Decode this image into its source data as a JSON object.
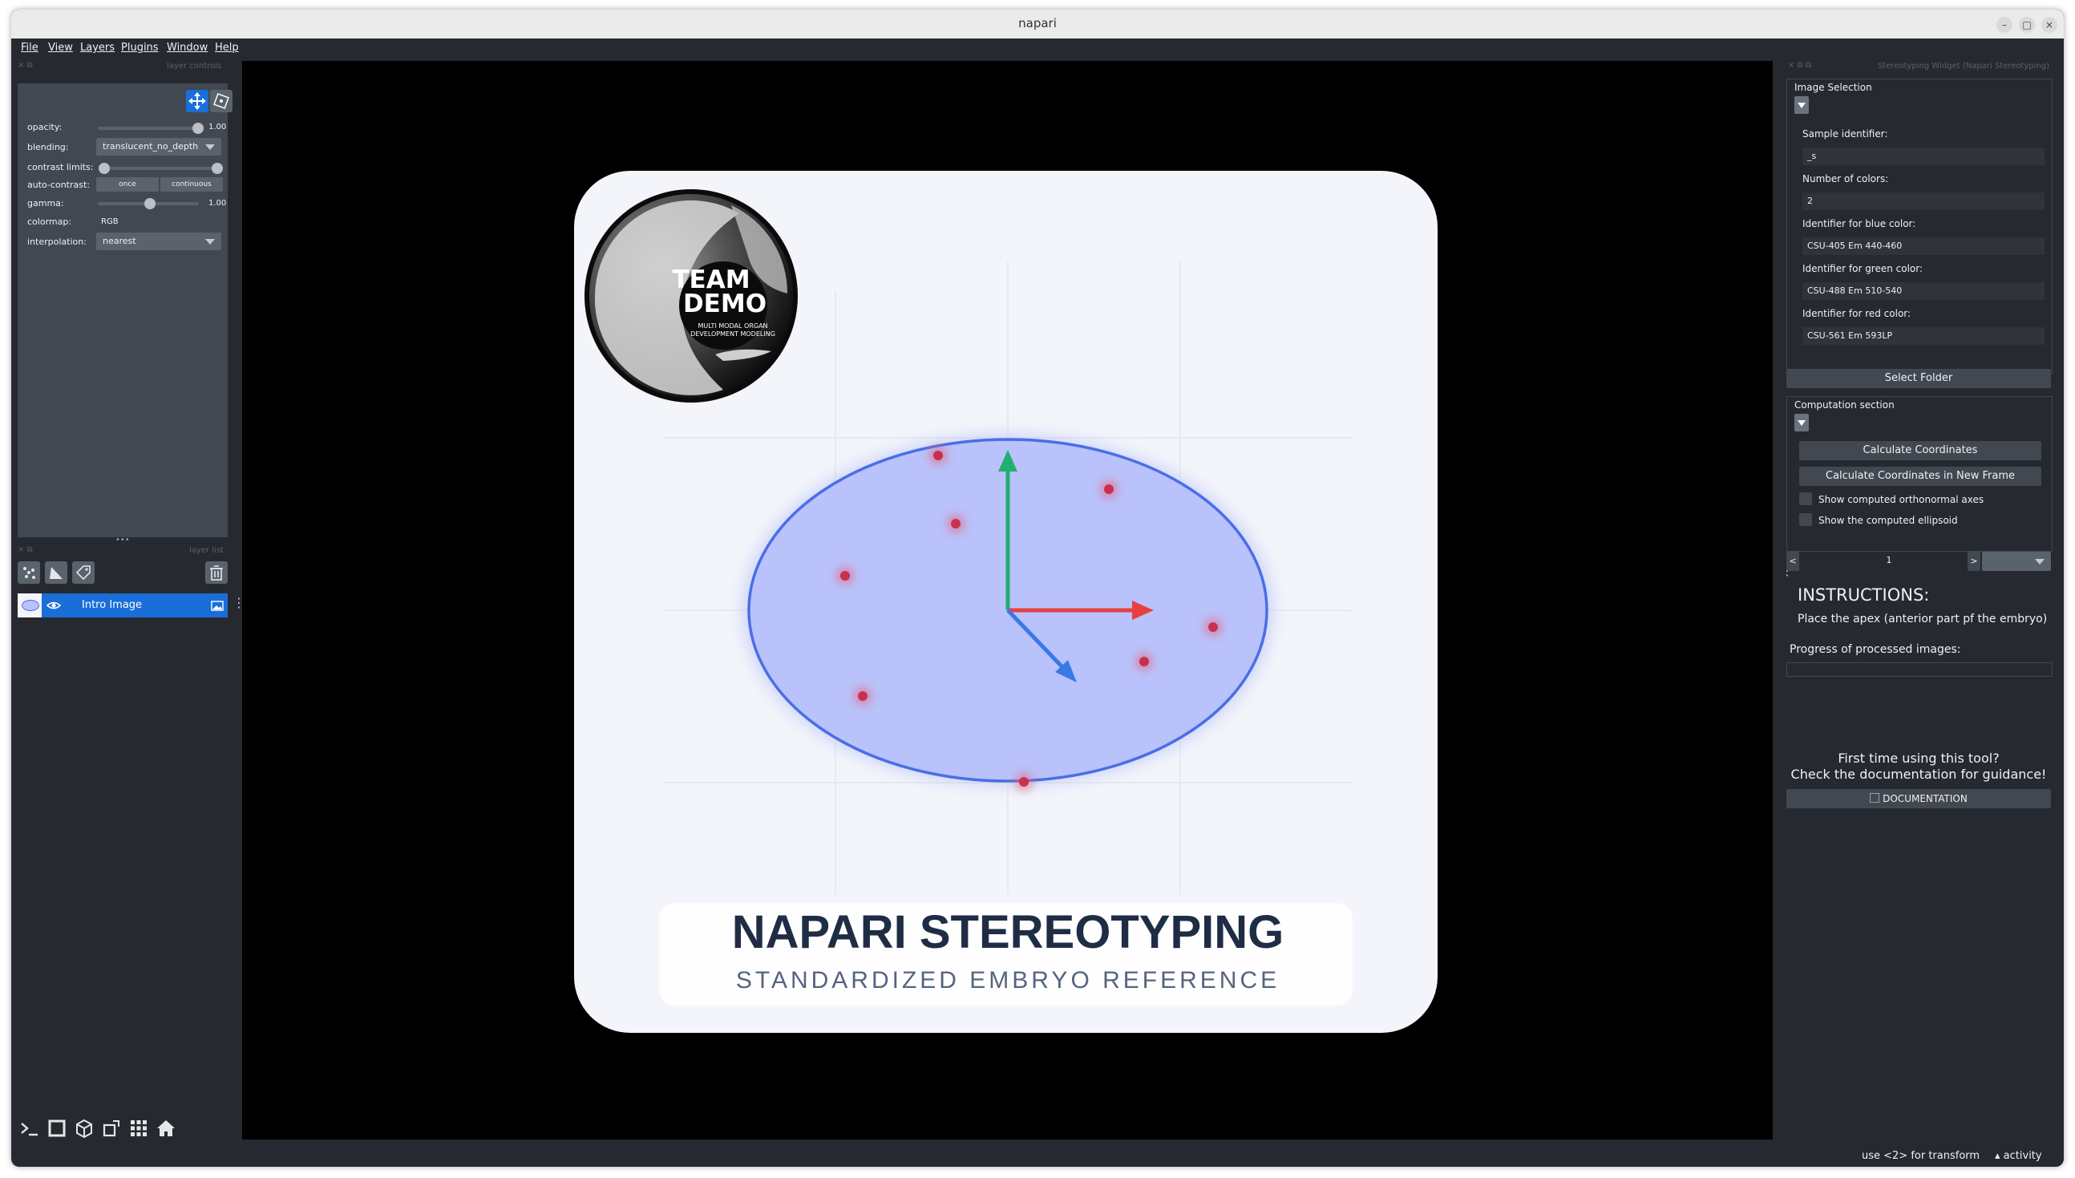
{
  "window": {
    "title": "napari",
    "minimize_glyph": "–",
    "maximize_glyph": "□",
    "close_glyph": "×"
  },
  "menu": [
    "File",
    "View",
    "Layers",
    "Plugins",
    "Window",
    "Help"
  ],
  "layer_controls": {
    "header": "layer controls",
    "opacity_label": "opacity:",
    "opacity_value": "1.00",
    "blending_label": "blending:",
    "blending_value": "translucent_no_depth",
    "contrast_label": "contrast limits:",
    "auto_contrast_label": "auto-contrast:",
    "once_label": "once",
    "continuous_label": "continuous",
    "gamma_label": "gamma:",
    "gamma_value": "1.00",
    "colormap_label": "colormap:",
    "colormap_value": "RGB",
    "interpolation_label": "interpolation:",
    "interpolation_value": "nearest",
    "splitter_glyph": "•••"
  },
  "layer_list": {
    "header": "layer list",
    "layers": [
      {
        "name": "Intro Image",
        "visible": true,
        "selected": true
      }
    ],
    "menu_glyph": "⋮"
  },
  "canvas": {
    "logo_line1": "TEAM",
    "logo_line2": "DEMO",
    "logo_sub1": "MULTI MODAL ORGAN",
    "logo_sub2": "DEVELOPMENT MODELING",
    "title": "NAPARI STEREOTYPING",
    "subtitle": "STANDARDIZED EMBRYO REFERENCE",
    "colors": {
      "axis_green": "#20b070",
      "axis_red": "#e84040",
      "axis_blue": "#3a78e6",
      "ellipse_fill": "#b9c2fa",
      "ellipse_stroke": "#4a6ee6",
      "dot": "#c9304e"
    }
  },
  "widget": {
    "header": "Stereotyping Widget (Napari Stereotyping)",
    "image_selection_label": "Image Selection",
    "sample_id_label": "Sample identifier:",
    "sample_id_value": "_s",
    "num_colors_label": "Number of colors:",
    "num_colors_value": "2",
    "blue_label": "Identifier for blue color:",
    "blue_value": "CSU-405 Em 440-460",
    "green_label": "Identifier for green color:",
    "green_value": "CSU-488 Em 510-540",
    "red_label": "Identifier for red color:",
    "red_value": "CSU-561 Em 593LP",
    "select_folder": "Select Folder",
    "computation_label": "Computation section",
    "calc_coords": "Calculate Coordinates",
    "calc_coords_new": "Calculate Coordinates in New Frame",
    "show_axes": "Show computed orthonormal axes",
    "show_ellipsoid": "Show the computed ellipsoid",
    "page_prev": "<",
    "page_value": "1",
    "page_next": ">",
    "instructions_title": "INSTRUCTIONS:",
    "instructions_text": "Place the apex (anterior part pf the embryo)",
    "progress_label": "Progress of processed images:",
    "progress": 0,
    "first_time_1": "First time using this tool?",
    "first_time_2": "Check the documentation for guidance!",
    "documentation": "DOCUMENTATION"
  },
  "status": {
    "hint": "use <2> for transform",
    "activity": "activity",
    "activity_glyph": "▴"
  },
  "icons": [
    "pan-zoom-icon",
    "transform-icon",
    "points-layer-icon",
    "shapes-layer-icon",
    "labels-layer-icon",
    "delete-icon",
    "eye-icon",
    "image-type-icon",
    "console-icon",
    "ndisplay-icon",
    "roll-icon",
    "transpose-icon",
    "grid-icon",
    "home-icon"
  ]
}
